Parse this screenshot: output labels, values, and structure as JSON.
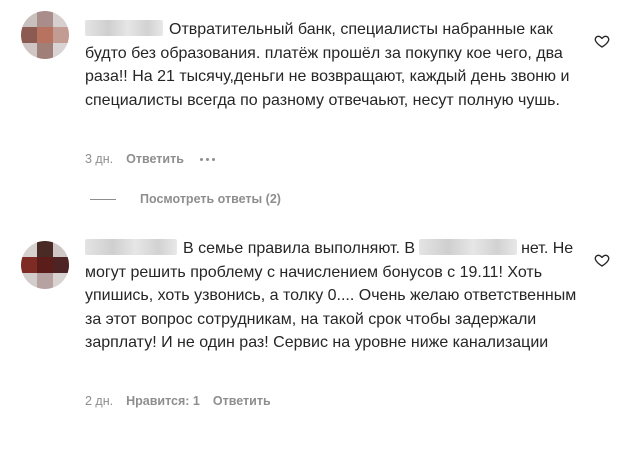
{
  "comments": [
    {
      "text": "Отвратительный банк, специалисты набранные как будто без образования. платёж прошёл за покупку кое чего, два раза!! На 21 тысячу,деньги не возвращают, каждый день звоню и специалисты всегда по разному отвечаьют, несут полную чушь.",
      "time": "3 дн.",
      "reply_label": "Ответить",
      "more_icon": "more-dots-icon",
      "like_icon": "heart-outline-icon"
    },
    {
      "text_before": "В семье правила выполняют. В",
      "text_after": "нет. Не могут решить проблему с начислением бонусов с 19.11! Хоть упишись, хоть узвонись, а толку 0.... Очень желаю ответственным за этот вопрос сотрудникам, на такой срок чтобы задержали зарплату! И не один раз! Сервис на уровне ниже канализации",
      "time": "2 дн.",
      "likes_label": "Нравится: 1",
      "reply_label": "Ответить",
      "like_icon": "heart-outline-icon"
    }
  ],
  "view_replies_label": "Посмотреть ответы (2)",
  "colors": {
    "text": "#262626",
    "secondary": "#8e8e8e",
    "background": "#ffffff"
  }
}
